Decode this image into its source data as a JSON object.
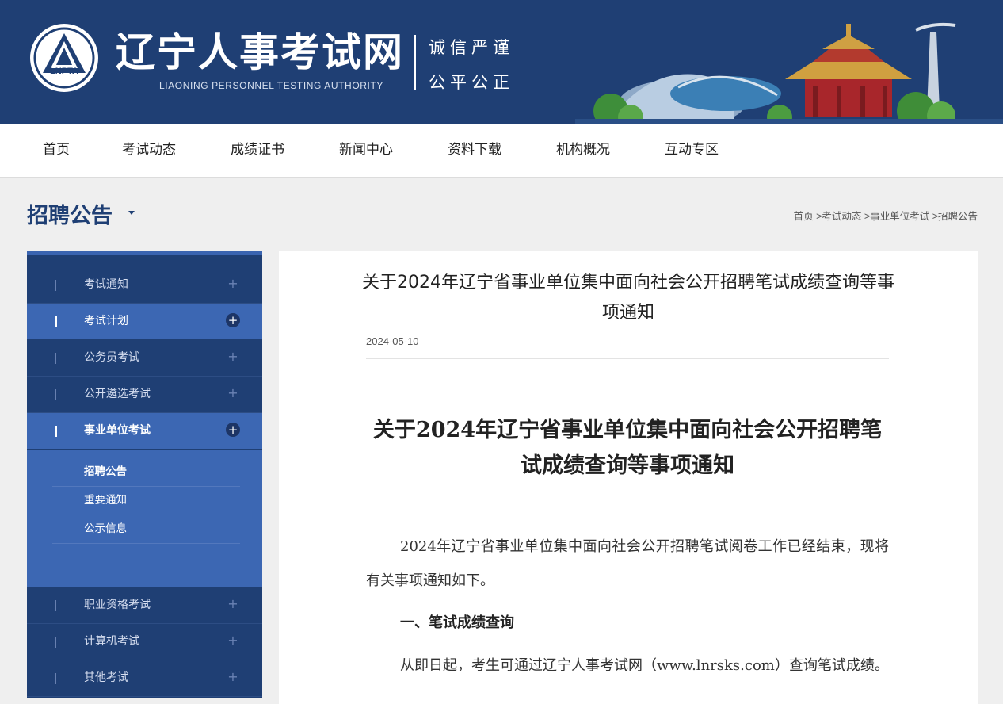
{
  "header": {
    "logo_text": "LNPTA",
    "site_title": "辽宁人事考试网",
    "site_subtitle": "LIAONING PERSONNEL TESTING AUTHORITY",
    "motto_line1": "诚信严谨",
    "motto_line2": "公平公正"
  },
  "nav": {
    "items": [
      "首页",
      "考试动态",
      "成绩证书",
      "新闻中心",
      "资料下载",
      "机构概况",
      "互动专区"
    ]
  },
  "page": {
    "title": "招聘公告",
    "breadcrumb": [
      "首页",
      ">考试动态",
      ">事业单位考试",
      ">招聘公告"
    ]
  },
  "sidebar": {
    "items": [
      {
        "label": "考试通知",
        "active": false
      },
      {
        "label": "考试计划",
        "active": true
      },
      {
        "label": "公务员考试",
        "active": false
      },
      {
        "label": "公开遴选考试",
        "active": false
      },
      {
        "label": "事业单位考试",
        "active": true
      },
      {
        "label": "职业资格考试",
        "active": false
      },
      {
        "label": "计算机考试",
        "active": false
      },
      {
        "label": "其他考试",
        "active": false
      }
    ],
    "submenu": [
      "招聘公告",
      "重要通知",
      "公示信息"
    ]
  },
  "article": {
    "title": "关于2024年辽宁省事业单位集中面向社会公开招聘笔试成绩查询等事项通知",
    "date": "2024-05-10",
    "doc_title": "关于2024年辽宁省事业单位集中面向社会公开招聘笔试成绩查询等事项通知",
    "para1": "2024年辽宁省事业单位集中面向社会公开招聘笔试阅卷工作已经结束，现将有关事项通知如下。",
    "heading1": "一、笔试成绩查询",
    "para2": "从即日起，考生可通过辽宁人事考试网（www.lnrsks.com）查询笔试成绩。"
  },
  "colors": {
    "brand_navy": "#1f3f74",
    "active_blue": "#3c67b3"
  }
}
